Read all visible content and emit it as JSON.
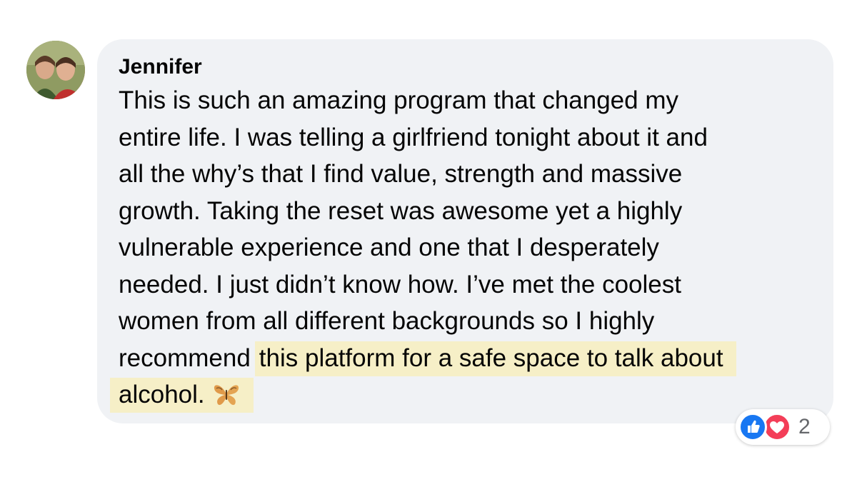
{
  "comment": {
    "author": "Jennifer",
    "lines": [
      "This is such an amazing program that changed my",
      "entire life. I was telling a girlfriend tonight about it and",
      "all the why’s that I find value, strength and massive",
      "growth. Taking the reset was awesome   yet a highly",
      "vulnerable experience and one that I desperately",
      "needed. I just didn’t know how. I’ve met the coolest",
      "women from all different backgrounds so I highly"
    ],
    "line8_plain": "recommend",
    "line8_highlight": "this platform for a safe space to talk about",
    "line9_highlight": "alcohol.",
    "emoji": "butterfly-icon",
    "reactions": {
      "types": [
        "like-icon",
        "love-icon"
      ],
      "count": "2"
    }
  },
  "colors": {
    "bubble": "#f0f2f5",
    "highlight": "#f6efc7",
    "like": "#1877f2",
    "love": "#f33e58",
    "text": "#050505",
    "muted": "#65676b"
  }
}
